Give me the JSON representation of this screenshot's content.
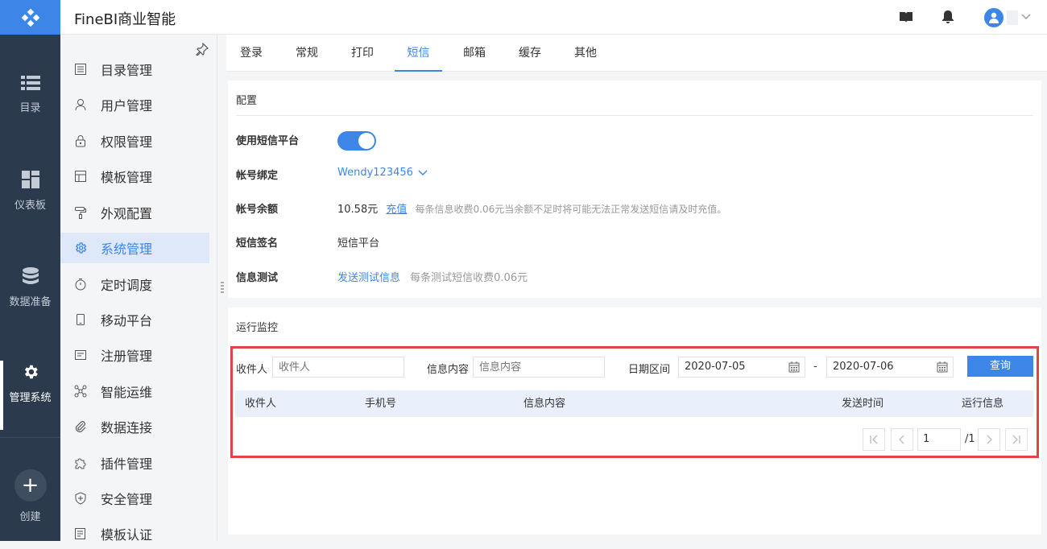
{
  "app": {
    "title": "FineBI商业智能"
  },
  "rail": {
    "items": [
      {
        "label": "目录",
        "icon": "list-icon"
      },
      {
        "label": "仪表板",
        "icon": "dashboard-icon"
      },
      {
        "label": "数据准备",
        "icon": "database-icon"
      },
      {
        "label": "管理系统",
        "icon": "gear-icon"
      }
    ],
    "create_label": "创建"
  },
  "menu": {
    "items": [
      {
        "label": "目录管理",
        "icon": "catalog-icon"
      },
      {
        "label": "用户管理",
        "icon": "user-icon"
      },
      {
        "label": "权限管理",
        "icon": "lock-icon"
      },
      {
        "label": "模板管理",
        "icon": "template-icon"
      },
      {
        "label": "外观配置",
        "icon": "paint-roller-icon"
      },
      {
        "label": "系统管理",
        "icon": "gear-icon"
      },
      {
        "label": "定时调度",
        "icon": "stopwatch-icon"
      },
      {
        "label": "移动平台",
        "icon": "mobile-icon"
      },
      {
        "label": "注册管理",
        "icon": "register-icon"
      },
      {
        "label": "智能运维",
        "icon": "network-icon"
      },
      {
        "label": "数据连接",
        "icon": "paperclip-icon"
      },
      {
        "label": "插件管理",
        "icon": "puzzle-icon"
      },
      {
        "label": "安全管理",
        "icon": "shield-icon"
      },
      {
        "label": "模板认证",
        "icon": "certificate-icon"
      }
    ],
    "active": "系统管理"
  },
  "tabs": [
    "登录",
    "常规",
    "打印",
    "短信",
    "邮箱",
    "缓存",
    "其他"
  ],
  "active_tab": "短信",
  "config": {
    "title": "配置",
    "platform_label": "使用短信平台",
    "platform_enabled": true,
    "account_label": "帐号绑定",
    "account_value": "Wendy123456",
    "balance_label": "帐号余额",
    "balance_value": "10.58元",
    "recharge_link": "充值",
    "balance_hint": "每条信息收费0.06元当余额不足时将可能无法正常发送短信请及时充值。",
    "signature_label": "短信签名",
    "signature_value": "短信平台",
    "test_label": "信息测试",
    "test_link": "发送测试信息",
    "test_hint": "每条测试短信收费0.06元"
  },
  "monitor": {
    "title": "运行监控",
    "recipient_label": "收件人",
    "recipient_placeholder": "收件人",
    "content_label": "信息内容",
    "content_placeholder": "信息内容",
    "date_label": "日期区间",
    "date_from": "2020-07-05",
    "date_sep": "-",
    "date_to": "2020-07-06",
    "query_button": "查询",
    "columns": [
      "收件人",
      "手机号",
      "信息内容",
      "发送时间",
      "运行信息"
    ],
    "page_current": "1",
    "page_total": "/1"
  },
  "colors": {
    "accent": "#3d86e8",
    "rail": "#2b3a4d",
    "highlight_border": "#e44343"
  }
}
